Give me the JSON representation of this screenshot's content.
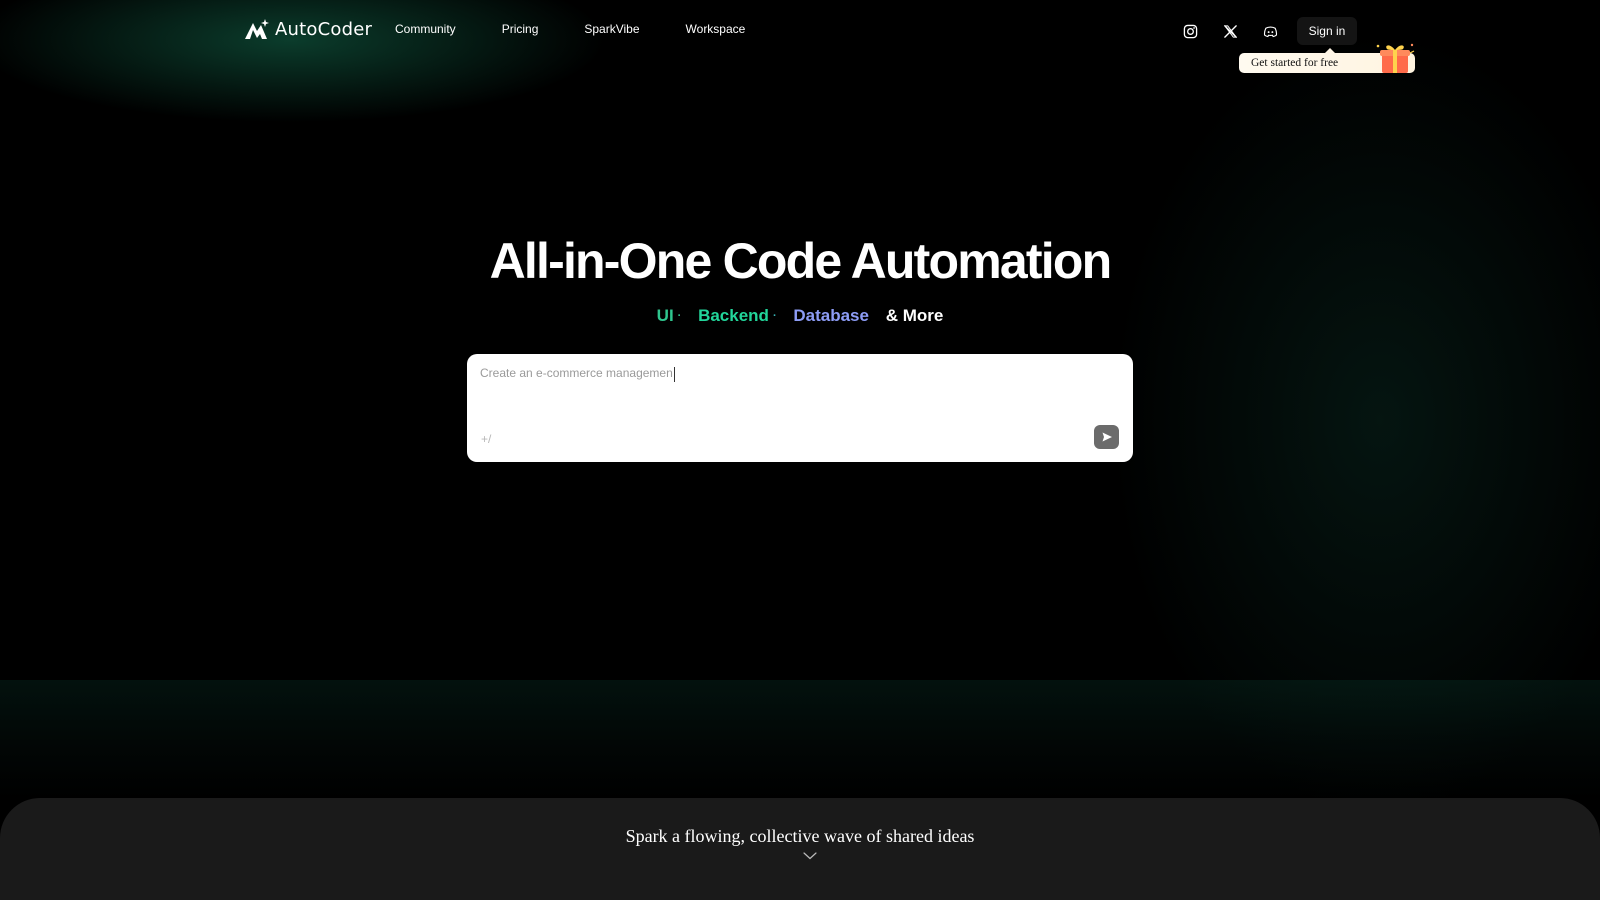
{
  "header": {
    "brand": "AutoCoder",
    "nav": [
      {
        "label": "Community"
      },
      {
        "label": "Pricing"
      },
      {
        "label": "SparkVibe"
      },
      {
        "label": "Workspace"
      }
    ],
    "social_icons": [
      "instagram-icon",
      "x-icon",
      "discord-icon"
    ],
    "signin_label": "Sign in",
    "promo_label": "Get started for free"
  },
  "hero": {
    "title": "All-in-One Code Automation",
    "features": {
      "ui": "UI",
      "backend": "Backend",
      "database": "Database",
      "more": "& More",
      "separator": "·"
    },
    "colors": {
      "ui": "#2fc58e",
      "backend": "#22d59a",
      "database": "#8d9cf5",
      "more": "#ffffff"
    }
  },
  "prompt": {
    "value": "Create an e-commerce managemen",
    "hint": "+/"
  },
  "footer": {
    "tagline": "Spark a flowing, collective wave of shared ideas"
  },
  "theme": {
    "background": "#000000",
    "accent_glow": "#146e50",
    "panel": "#1a1a1a"
  }
}
